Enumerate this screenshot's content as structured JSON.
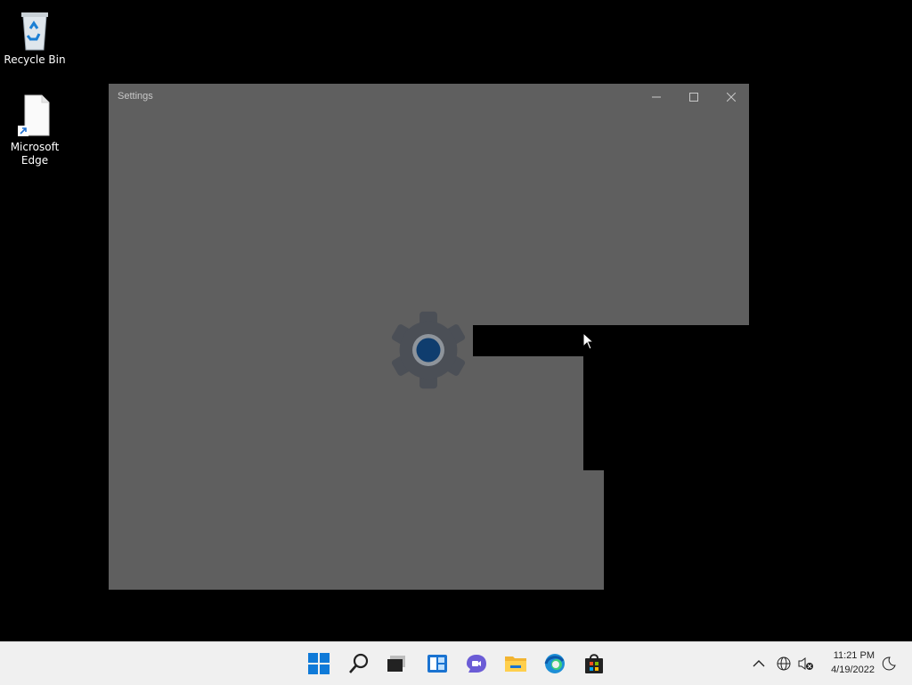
{
  "desktop": {
    "icons": [
      {
        "label": "Recycle Bin",
        "icon": "recycle-bin-icon"
      },
      {
        "label": "Microsoft Edge",
        "icon": "edge-shortcut-icon"
      }
    ]
  },
  "window": {
    "title": "Settings",
    "app_icon": "gear-icon",
    "controls": {
      "minimize": "minimize-icon",
      "maximize": "maximize-icon",
      "close": "close-icon"
    }
  },
  "taskbar": {
    "items": [
      "start-icon",
      "search-icon",
      "task-view-icon",
      "widgets-icon",
      "chat-icon",
      "file-explorer-icon",
      "edge-icon",
      "store-icon"
    ],
    "tray": {
      "icons": [
        "chevron-up-icon",
        "network-icon",
        "volume-muted-icon",
        "focus-assist-icon"
      ],
      "time": "11:21 PM",
      "date": "4/19/2022"
    }
  },
  "colors": {
    "window_bg": "#5f5f5f",
    "accent": "#0078d4",
    "taskbar_bg": "#f0f0f0"
  }
}
